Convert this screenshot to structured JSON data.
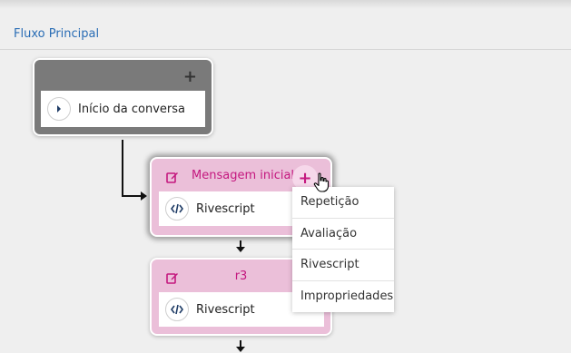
{
  "header": {
    "flow_title": "Fluxo Principal"
  },
  "start_card": {
    "add_symbol": "+",
    "item_label": "Início da conversa",
    "item_icon": "play-icon"
  },
  "message_card": {
    "title": "Mensagem inicial",
    "add_symbol": "+",
    "item_label": "Rivescript",
    "item_icon": "code-icon"
  },
  "r3_card": {
    "title": "r3",
    "item_label": "Rivescript",
    "item_icon": "code-icon"
  },
  "add_menu": {
    "items": [
      {
        "label": "Repetição"
      },
      {
        "label": "Avaliação"
      },
      {
        "label": "Rivescript"
      },
      {
        "label": "Impropriedades"
      }
    ]
  },
  "colors": {
    "accent": "#c4187f",
    "title_link": "#2a6db5",
    "start_card": "#7a7a7a",
    "message_card": "#ebbfd9"
  }
}
